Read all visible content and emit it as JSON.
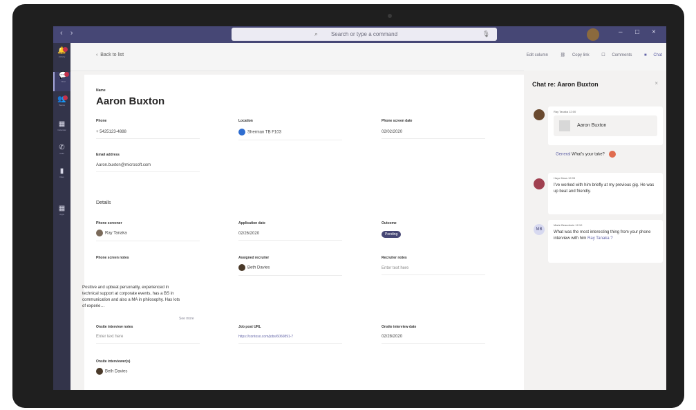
{
  "titlebar": {
    "back_forward": "‹ ›",
    "search_placeholder": "Search or type a command",
    "minimize": "–",
    "maximize": "□",
    "close": "×"
  },
  "rail": [
    {
      "label": "Activity",
      "icon": "bell-icon"
    },
    {
      "label": "Chat",
      "icon": "chat-icon"
    },
    {
      "label": "Teams",
      "icon": "teams-icon"
    },
    {
      "label": "Calendar",
      "icon": "calendar-icon"
    },
    {
      "label": "Calls",
      "icon": "phone-icon"
    },
    {
      "label": "Files",
      "icon": "file-icon"
    },
    {
      "label": "Apps",
      "icon": "apps-icon"
    }
  ],
  "topbar": {
    "back_label": "Back to list",
    "edit_label": "Edit column",
    "copy_link_label": "Copy link",
    "comments_label": "Comments",
    "chat_label": "Chat"
  },
  "record": {
    "name_label": "Name",
    "name": "Aaron Buxton",
    "phone_label": "Phone",
    "phone": "+ 5425123-4888",
    "location_label": "Location",
    "location": "Sherman TB F103",
    "phone_screen_date_label": "Phone screen date",
    "phone_screen_date": "02/02/2020",
    "email_label": "Email address",
    "email": "Aaron.buxton@microsoft.com",
    "details_heading": "Details",
    "phone_screener_label": "Phone screener",
    "phone_screener": "Ray Tanaka",
    "application_date_label": "Application date",
    "application_date": "02/26/2020",
    "outcome_label": "Outcome",
    "outcome": "Pending",
    "phone_notes_label": "Phone screen notes",
    "phone_notes": "Positive and upbeat personality, experienced in technical support at corporate events, has a BS in communication and also a MA in philosophy. Has lots of experie…",
    "see_more": "See more",
    "assigned_recruiter_label": "Assigned recruiter",
    "assigned_recruiter": "Beth Davies",
    "recruiter_notes_label": "Recruiter notes",
    "recruiter_notes_placeholder": "Enter text here",
    "onsite_notes_label": "Onsite interview notes",
    "onsite_notes_placeholder": "Enter text here",
    "job_post_label": "Job post URL",
    "job_post": "https://contoso.com/jobs/6060891-7",
    "onsite_date_label": "Onsite interview date",
    "onsite_date": "02/28/2020",
    "onsite_interviewers_label": "Onsite interviewer(s)",
    "onsite_interviewer": "Beth Davies"
  },
  "chat": {
    "title": "Chat re: Aaron Buxton",
    "messages": [
      {
        "author": "Ray Tanaka 12:00",
        "card_name": "Aaron Buxton",
        "reply_channel": "General",
        "reply_text": "What's your take?"
      },
      {
        "author": "Hayo Moss 12:05",
        "text": "I've worked with him briefly at my previous gig. He was up beat and friendly."
      },
      {
        "author": "Marie Beaudouin 12:10",
        "initials": "MB",
        "text": "What was the most interesting thing from your phone interview with him",
        "mention": "Ray Tanaka ?"
      }
    ]
  },
  "colors": {
    "accent": "#6264a7",
    "titlebar": "#464775",
    "rail": "#33344a",
    "badge": "#c4314b"
  }
}
